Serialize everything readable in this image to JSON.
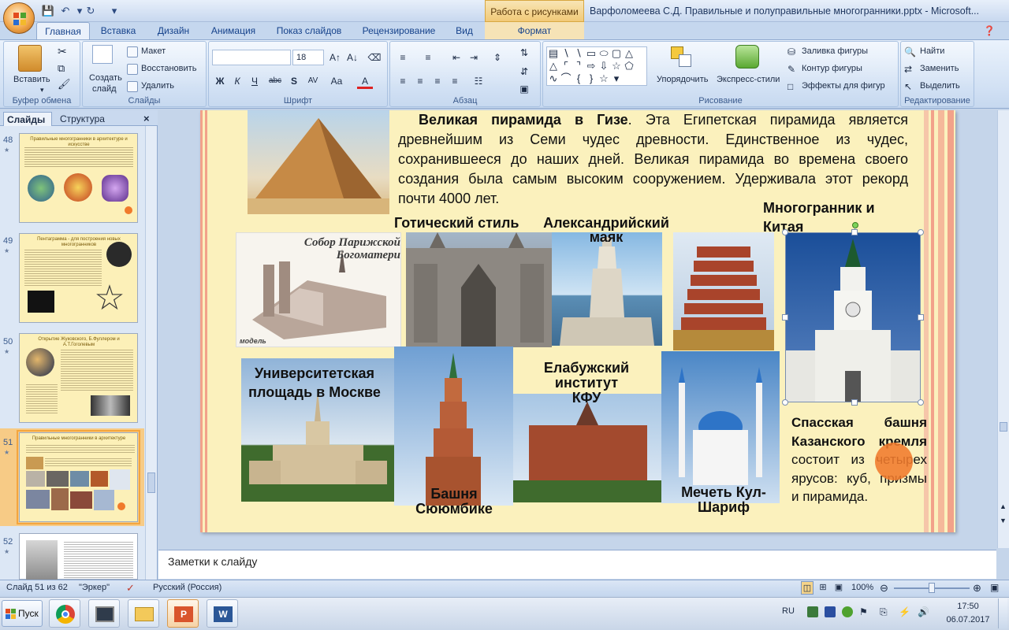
{
  "window": {
    "title": "Варфоломеева С.Д. Правильные и полуправильные многогранники.pptx - Microsoft...",
    "context_tab_group": "Работа с рисунками"
  },
  "ribbon_tabs": [
    "Главная",
    "Вставка",
    "Дизайн",
    "Анимация",
    "Показ слайдов",
    "Рецензирование",
    "Вид",
    "Формат"
  ],
  "ribbon": {
    "clipboard": {
      "paste": "Вставить",
      "label": "Буфер обмена"
    },
    "slides": {
      "new_slide_1": "Создать",
      "new_slide_2": "слайд",
      "layout": "Макет",
      "reset": "Восстановить",
      "delete": "Удалить",
      "label": "Слайды"
    },
    "font": {
      "size": "18",
      "label": "Шрифт",
      "bold": "Ж",
      "italic": "К",
      "underline": "Ч",
      "strike": "abc",
      "shadow": "S",
      "spacing": "AV",
      "case": "Aa",
      "color": "A"
    },
    "paragraph": {
      "label": "Абзац"
    },
    "drawing": {
      "arrange": "Упорядочить",
      "quick_styles": "Экспресс-стили",
      "fill": "Заливка фигуры",
      "outline": "Контур фигуры",
      "effects": "Эффекты для фигур",
      "label": "Рисование"
    },
    "editing": {
      "find": "Найти",
      "replace": "Заменить",
      "select": "Выделить",
      "label": "Редактирование"
    }
  },
  "left_panel": {
    "tabs": [
      "Слайды",
      "Структура"
    ],
    "thumbnails": [
      {
        "num": "48",
        "title": "Правильные многогранники в архитектуре и искусстве"
      },
      {
        "num": "49",
        "title": "Пентаграмма - для построения новых многогранников"
      },
      {
        "num": "50",
        "title": "Открытие Жуковского, Б.Фуллером и А.Т.Гоголевым"
      },
      {
        "num": "51",
        "title": "Правильные многогранники в архитектуре"
      },
      {
        "num": "52",
        "title": ""
      }
    ]
  },
  "slide": {
    "paragraph_bold": "Великая пирамида в Гизе",
    "paragraph_rest": ". Эта Египетская пирамида является древнейшим из Семи чудес древности. Единственное из чудес, сохранившееся до наших дней. Великая пирамида во времена своего создания была самым высоким сооружением. Удерживала этот рекорд почти 4000 лет.",
    "captions": {
      "gothic": "Готический стиль",
      "lighthouse": "Александрийский маяк",
      "china": "Многогранник и Китая",
      "university": "Университетская площадь в Москве",
      "elabuga": "Елабужский институт КФУ",
      "syuyumbike": "Башня Сююмбике",
      "mosque": "Мечеть Кул-Шариф"
    },
    "notre_dame_img_text_1": "Собор Парижской",
    "notre_dame_img_text_2": "Богоматери",
    "notre_dame_img_text_3": "модель",
    "spasskaya_bold": "Спасская башня Казанского кремля",
    "spasskaya_rest": " состоит из четырех ярусов: куб, призмы и пирамида."
  },
  "notes_placeholder": "Заметки к слайду",
  "status": {
    "slide_of": "Слайд 51 из 62",
    "theme": "\"Эркер\"",
    "language": "Русский (Россия)",
    "zoom": "100%"
  },
  "taskbar": {
    "start": "Пуск",
    "lang": "RU",
    "time": "17:50",
    "date": "06.07.2017"
  },
  "colors": {
    "accent": "#f4a53d",
    "slide_bg": "#fbf1bd",
    "ribbon": "#dbe7f6"
  }
}
